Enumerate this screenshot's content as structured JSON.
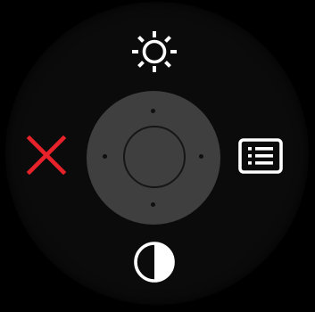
{
  "osd_menu": {
    "colors": {
      "background": "#000000",
      "ring": "#0b0b0b",
      "joystick": "#3f3f3f",
      "icon": "#ffffff",
      "exit": "#e8222a"
    },
    "buttons": [
      {
        "position": "top",
        "icon": "brightness-sun-icon"
      },
      {
        "position": "right",
        "icon": "menu-list-icon"
      },
      {
        "position": "bottom",
        "icon": "contrast-icon"
      },
      {
        "position": "left",
        "icon": "close-x-icon"
      }
    ],
    "joystick": {
      "directions": [
        "up",
        "right",
        "down",
        "left"
      ]
    }
  }
}
